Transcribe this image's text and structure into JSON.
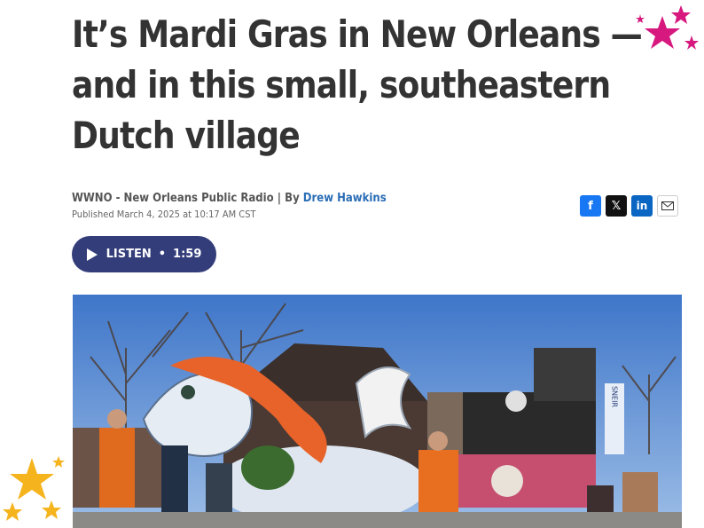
{
  "article": {
    "headline_lines": [
      "It’s Mardi Gras in New Orleans —",
      "and in this small, southeastern",
      "Dutch village"
    ],
    "source": "WWNO - New Orleans Public Radio",
    "by_prefix": "| By",
    "author": "Drew Hawkins",
    "published": "Published March 4, 2025 at 10:17 AM CST"
  },
  "share": {
    "facebook": "f",
    "x": "𝕏",
    "linkedin": "in",
    "email_icon": "mail-icon"
  },
  "audio": {
    "listen_label": "LISTEN",
    "separator": "•",
    "duration": "1:59"
  },
  "photo": {
    "icon": "parade-photo",
    "sign_text": "SNEIR"
  },
  "decor": {
    "pink_stars": "star-icon",
    "gold_stars": "star-icon",
    "colors": {
      "pink": "#d6187f",
      "gold": "#f5b41e",
      "listen_bg": "#333d7a",
      "author_link": "#2a6db5"
    }
  }
}
